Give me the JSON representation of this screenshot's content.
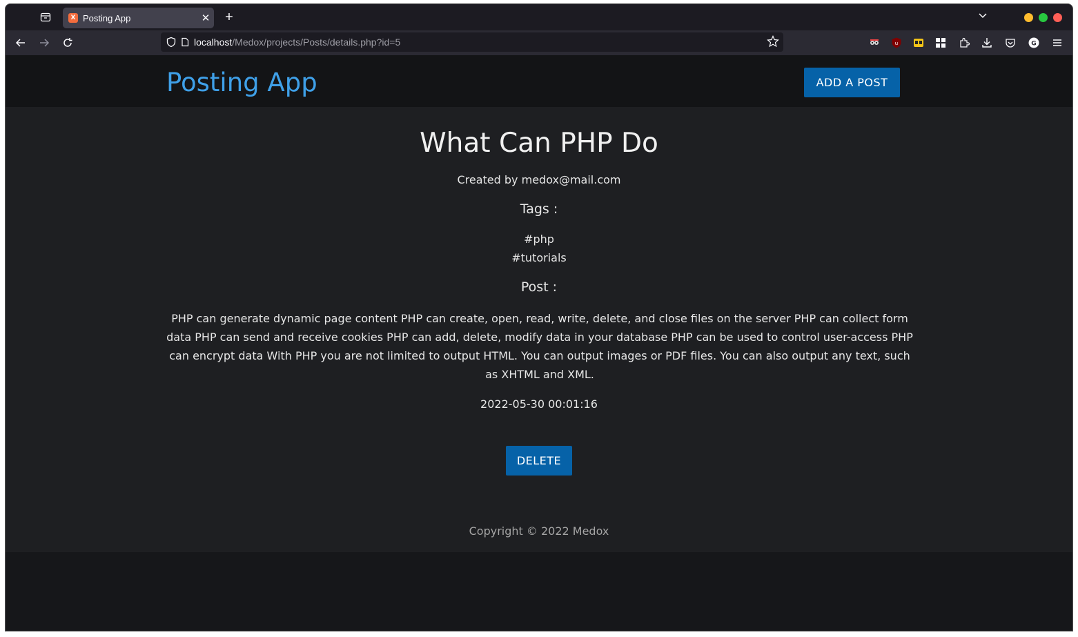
{
  "browser": {
    "tab_title": "Posting App",
    "tab_favicon_text": "X",
    "url_host": "localhost",
    "url_path": "/Medox/projects/Posts/details.php?id=5"
  },
  "header": {
    "brand": "Posting App",
    "add_post_label": "ADD A POST"
  },
  "post": {
    "title": "What Can PHP Do",
    "created_by": "Created by medox@mail.com",
    "tags_heading": "Tags :",
    "tags": [
      "#php",
      "#tutorials"
    ],
    "post_heading": "Post :",
    "body": "PHP can generate dynamic page content PHP can create, open, read, write, delete, and close files on the server PHP can collect form data PHP can send and receive cookies PHP can add, delete, modify data in your database PHP can be used to control user-access PHP can encrypt data With PHP you are not limited to output HTML. You can output images or PDF files. You can also output any text, such as XHTML and XML.",
    "date": "2022-05-30 00:01:16",
    "delete_label": "DELETE"
  },
  "footer": {
    "copyright": "Copyright © 2022 Medox"
  },
  "colors": {
    "brand": "#3fa0e8",
    "button": "#0662a8"
  }
}
